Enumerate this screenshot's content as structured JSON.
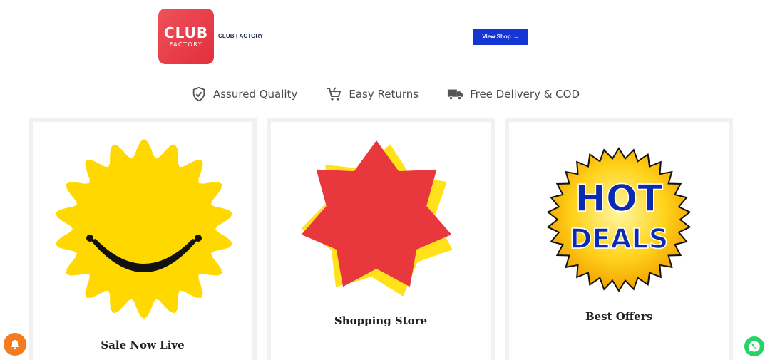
{
  "header": {
    "logo_big": "CLUB",
    "logo_small": "FACTORY",
    "brand_name": "CLUB FACTORY",
    "view_shop_label": "View Shop",
    "view_shop_arrow": "→"
  },
  "features": [
    {
      "icon": "shield-check-icon",
      "label": "Assured Quality"
    },
    {
      "icon": "cart-return-icon",
      "label": "Easy Returns"
    },
    {
      "icon": "delivery-truck-icon",
      "label": "Free Delivery & COD"
    }
  ],
  "cards": [
    {
      "title": "Sale Now Live",
      "image": "smiling-sun"
    },
    {
      "title": "Shopping Store",
      "image": "red-star-badge"
    },
    {
      "title": "Best Offers",
      "image": "hot-deals-badge",
      "badge_line1": "HOT",
      "badge_line2": "DEALS"
    }
  ],
  "colors": {
    "brand_red": "#e8394a",
    "button_blue": "#1436d6",
    "sun_yellow": "#ffd800",
    "star_red": "#e8373d",
    "deal_blue": "#0a2bb0",
    "bell_orange": "#f47c20",
    "whatsapp_green": "#25d366"
  }
}
